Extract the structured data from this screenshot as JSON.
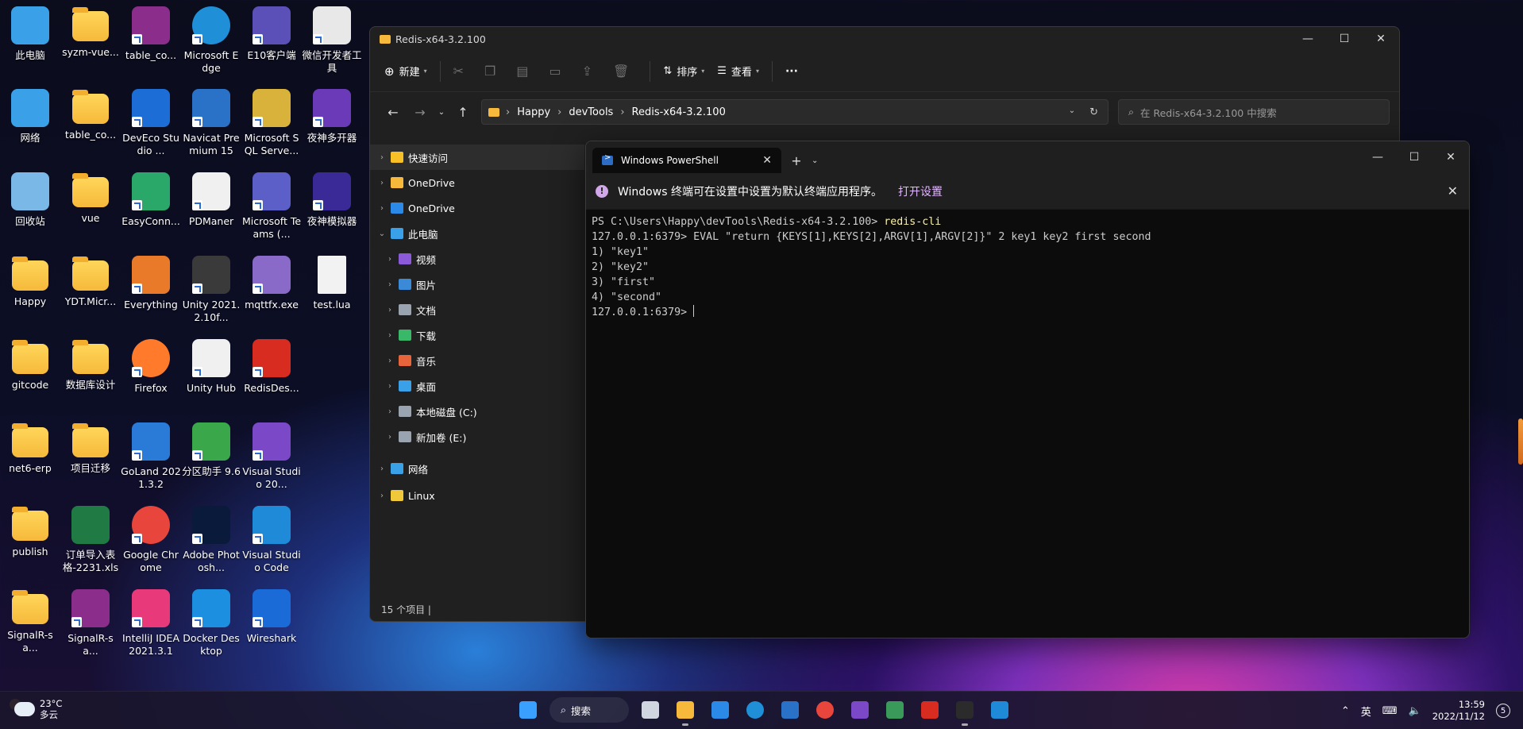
{
  "desktop_icons": [
    {
      "label": "此电脑",
      "icon": "computer-icon",
      "color": "#3aa0e8",
      "col": 0,
      "row": 0
    },
    {
      "label": "syzm-vue...",
      "icon": "folder-icon",
      "color": "#f6b93b",
      "col": 1,
      "row": 0
    },
    {
      "label": "table_co...",
      "icon": "winrar-icon",
      "color": "#8b2d8b",
      "col": 2,
      "row": 0
    },
    {
      "label": "Microsoft Edge",
      "icon": "edge-icon",
      "color": "#1f8fd8",
      "col": 3,
      "row": 0
    },
    {
      "label": "E10客户端",
      "icon": "e10-icon",
      "color": "#5b4fb8",
      "col": 4,
      "row": 0
    },
    {
      "label": "微信开发者工具",
      "icon": "wechat-devtools-icon",
      "color": "#e8e8e8",
      "col": 5,
      "row": 0
    },
    {
      "label": "网络",
      "icon": "network-icon",
      "color": "#3aa0e8",
      "col": 0,
      "row": 1
    },
    {
      "label": "table_co...",
      "icon": "folder-icon",
      "color": "#f6b93b",
      "col": 1,
      "row": 1
    },
    {
      "label": "DevEco Studio ...",
      "icon": "deveco-icon",
      "color": "#1c6ed6",
      "col": 2,
      "row": 1
    },
    {
      "label": "Navicat Premium 15",
      "icon": "navicat-icon",
      "color": "#2a72c8",
      "col": 3,
      "row": 1
    },
    {
      "label": "Microsoft SQL Serve...",
      "icon": "sqlserver-icon",
      "color": "#d8b23a",
      "col": 4,
      "row": 1
    },
    {
      "label": "夜神多开器",
      "icon": "nox-multi-icon",
      "color": "#6a3ab8",
      "col": 5,
      "row": 1
    },
    {
      "label": "回收站",
      "icon": "recycle-bin-icon",
      "color": "#7ab8e8",
      "col": 0,
      "row": 2
    },
    {
      "label": "vue",
      "icon": "folder-icon",
      "color": "#f6b93b",
      "col": 1,
      "row": 2
    },
    {
      "label": "EasyConn...",
      "icon": "easyconnect-icon",
      "color": "#2aa86a",
      "col": 2,
      "row": 2
    },
    {
      "label": "PDManer",
      "icon": "pdmaner-icon",
      "color": "#f0f0f0",
      "col": 3,
      "row": 2
    },
    {
      "label": "Microsoft Teams (...",
      "icon": "teams-icon",
      "color": "#5b5fc7",
      "col": 4,
      "row": 2
    },
    {
      "label": "夜神模拟器",
      "icon": "nox-icon",
      "color": "#3a2a98",
      "col": 5,
      "row": 2
    },
    {
      "label": "Happy",
      "icon": "folder-icon",
      "color": "#f6b93b",
      "col": 0,
      "row": 3
    },
    {
      "label": "YDT.Micr...",
      "icon": "folder-icon",
      "color": "#f6b93b",
      "col": 1,
      "row": 3
    },
    {
      "label": "Everything",
      "icon": "everything-icon",
      "color": "#e87a2a",
      "col": 2,
      "row": 3
    },
    {
      "label": "Unity 2021.2.10f...",
      "icon": "unity-icon",
      "color": "#3a3a3a",
      "col": 3,
      "row": 3
    },
    {
      "label": "mqttfx.exe",
      "icon": "mqttfx-icon",
      "color": "#8a6ac8",
      "col": 4,
      "row": 3
    },
    {
      "label": "test.lua",
      "icon": "file-icon",
      "color": "#f2f2f2",
      "col": 5,
      "row": 3
    },
    {
      "label": "gitcode",
      "icon": "folder-icon",
      "color": "#f6b93b",
      "col": 0,
      "row": 4
    },
    {
      "label": "数据库设计",
      "icon": "folder-icon",
      "color": "#f6b93b",
      "col": 1,
      "row": 4
    },
    {
      "label": "Firefox",
      "icon": "firefox-icon",
      "color": "#ff7a2a",
      "col": 2,
      "row": 4
    },
    {
      "label": "Unity Hub",
      "icon": "unity-hub-icon",
      "color": "#f0f0f0",
      "col": 3,
      "row": 4
    },
    {
      "label": "RedisDes...",
      "icon": "redis-icon",
      "color": "#d82c20",
      "col": 4,
      "row": 4
    },
    {
      "label": "net6-erp",
      "icon": "folder-icon",
      "color": "#f6b93b",
      "col": 0,
      "row": 5
    },
    {
      "label": "项目迁移",
      "icon": "folder-icon",
      "color": "#f6b93b",
      "col": 1,
      "row": 5
    },
    {
      "label": "GoLand 2021.3.2",
      "icon": "goland-icon",
      "color": "#2a7ad8",
      "col": 2,
      "row": 5
    },
    {
      "label": "分区助手 9.6",
      "icon": "partition-icon",
      "color": "#3aa84a",
      "col": 3,
      "row": 5
    },
    {
      "label": "Visual Studio 20...",
      "icon": "visual-studio-icon",
      "color": "#7b48c8",
      "col": 4,
      "row": 5
    },
    {
      "label": "publish",
      "icon": "folder-icon",
      "color": "#f6b93b",
      "col": 0,
      "row": 6
    },
    {
      "label": "订单导入表格-2231.xls",
      "icon": "excel-icon",
      "color": "#1f7a44",
      "col": 1,
      "row": 6
    },
    {
      "label": "Google Chrome",
      "icon": "chrome-icon",
      "color": "#e8453c",
      "col": 2,
      "row": 6
    },
    {
      "label": "Adobe Photosh...",
      "icon": "photoshop-icon",
      "color": "#0a1a3a",
      "col": 3,
      "row": 6
    },
    {
      "label": "Visual Studio Code",
      "icon": "vscode-icon",
      "color": "#1f8ad8",
      "col": 4,
      "row": 6
    },
    {
      "label": "SignalR-sa...",
      "icon": "folder-icon",
      "color": "#f6b93b",
      "col": 0,
      "row": 7
    },
    {
      "label": "SignalR-sa...",
      "icon": "winrar-icon",
      "color": "#8b2d8b",
      "col": 1,
      "row": 7
    },
    {
      "label": "IntelliJ IDEA 2021.3.1",
      "icon": "intellij-icon",
      "color": "#e83a7a",
      "col": 2,
      "row": 7
    },
    {
      "label": "Docker Desktop",
      "icon": "docker-icon",
      "color": "#1d8fe0",
      "col": 3,
      "row": 7
    },
    {
      "label": "Wireshark",
      "icon": "wireshark-icon",
      "color": "#1a6ad8",
      "col": 4,
      "row": 7
    }
  ],
  "explorer": {
    "title": "Redis-x64-3.2.100",
    "toolbar": {
      "new_label": "新建",
      "sort_label": "排序",
      "view_label": "查看",
      "more_label": "···"
    },
    "breadcrumb": [
      "Happy",
      "devTools",
      "Redis-x64-3.2.100"
    ],
    "search_placeholder": "在 Redis-x64-3.2.100 中搜索",
    "sidebar": [
      {
        "label": "快速访问",
        "icon": "star-icon",
        "color": "#f6c026",
        "indent": 0,
        "selected": true
      },
      {
        "label": "OneDrive",
        "icon": "folder-icon",
        "color": "#f6b93b",
        "indent": 0
      },
      {
        "label": "OneDrive",
        "icon": "cloud-icon",
        "color": "#2b8ae8",
        "indent": 0
      },
      {
        "label": "此电脑",
        "icon": "computer-icon",
        "color": "#3aa0e8",
        "indent": 0,
        "expanded": true
      },
      {
        "label": "视频",
        "icon": "video-icon",
        "color": "#8a5ad8",
        "indent": 1
      },
      {
        "label": "图片",
        "icon": "picture-icon",
        "color": "#3a8ad8",
        "indent": 1
      },
      {
        "label": "文档",
        "icon": "document-icon",
        "color": "#9aa4b0",
        "indent": 1
      },
      {
        "label": "下载",
        "icon": "download-icon",
        "color": "#3ab86a",
        "indent": 1
      },
      {
        "label": "音乐",
        "icon": "music-icon",
        "color": "#e8643a",
        "indent": 1
      },
      {
        "label": "桌面",
        "icon": "desktop-icon",
        "color": "#3aa0e8",
        "indent": 1
      },
      {
        "label": "本地磁盘 (C:)",
        "icon": "drive-icon",
        "color": "#9aa4b0",
        "indent": 1
      },
      {
        "label": "新加卷 (E:)",
        "icon": "drive-icon",
        "color": "#9aa4b0",
        "indent": 1
      },
      {
        "label": "网络",
        "icon": "network-icon",
        "color": "#3aa0e8",
        "indent": 0
      },
      {
        "label": "Linux",
        "icon": "linux-icon",
        "color": "#f0c83a",
        "indent": 0
      }
    ],
    "status": "15 个项目  |"
  },
  "terminal": {
    "tab_title": "Windows PowerShell",
    "notice_text": "Windows 终端可在设置中设置为默认终端应用程序。",
    "notice_link": "打开设置",
    "lines": [
      {
        "prefix": "PS C:\\Users\\Happy\\devTools\\Redis-x64-3.2.100> ",
        "cmd": "redis-cli"
      },
      {
        "prefix": "127.0.0.1:6379> EVAL \"return {KEYS[1],KEYS[2],ARGV[1],ARGV[2]}\" 2 key1 key2 first second",
        "cmd": ""
      },
      {
        "prefix": "1) \"key1\"",
        "cmd": ""
      },
      {
        "prefix": "2) \"key2\"",
        "cmd": ""
      },
      {
        "prefix": "3) \"first\"",
        "cmd": ""
      },
      {
        "prefix": "4) \"second\"",
        "cmd": ""
      },
      {
        "prefix": "127.0.0.1:6379> ",
        "cmd": "",
        "cursor": true
      }
    ]
  },
  "taskbar": {
    "weather_temp": "23°C",
    "weather_desc": "多云",
    "search_label": "搜索",
    "apps": [
      {
        "name": "start-button",
        "icon": "windows-icon",
        "color": "#3aa0ff"
      },
      {
        "name": "task-view",
        "icon": "task-view-icon",
        "color": "#cfd6e0"
      },
      {
        "name": "file-explorer",
        "icon": "folder-icon",
        "color": "#f6b93b",
        "active": true
      },
      {
        "name": "microsoft-store",
        "icon": "store-icon",
        "color": "#2b8ae8"
      },
      {
        "name": "edge",
        "icon": "edge-icon",
        "color": "#1f8fd8"
      },
      {
        "name": "navicat",
        "icon": "navicat-icon",
        "color": "#2a72c8"
      },
      {
        "name": "chrome",
        "icon": "chrome-icon",
        "color": "#e8453c"
      },
      {
        "name": "visual-studio",
        "icon": "visual-studio-icon",
        "color": "#7b48c8"
      },
      {
        "name": "notepad-app",
        "icon": "notepad-icon",
        "color": "#3a9a5a"
      },
      {
        "name": "redis-desktop",
        "icon": "redis-icon",
        "color": "#d82c20"
      },
      {
        "name": "terminal",
        "icon": "terminal-icon",
        "color": "#2b2b2b",
        "active": true
      },
      {
        "name": "vscode",
        "icon": "vscode-icon",
        "color": "#1f8ad8"
      }
    ],
    "ime": "英",
    "time": "13:59",
    "date": "2022/11/12",
    "notification_count": "5"
  }
}
